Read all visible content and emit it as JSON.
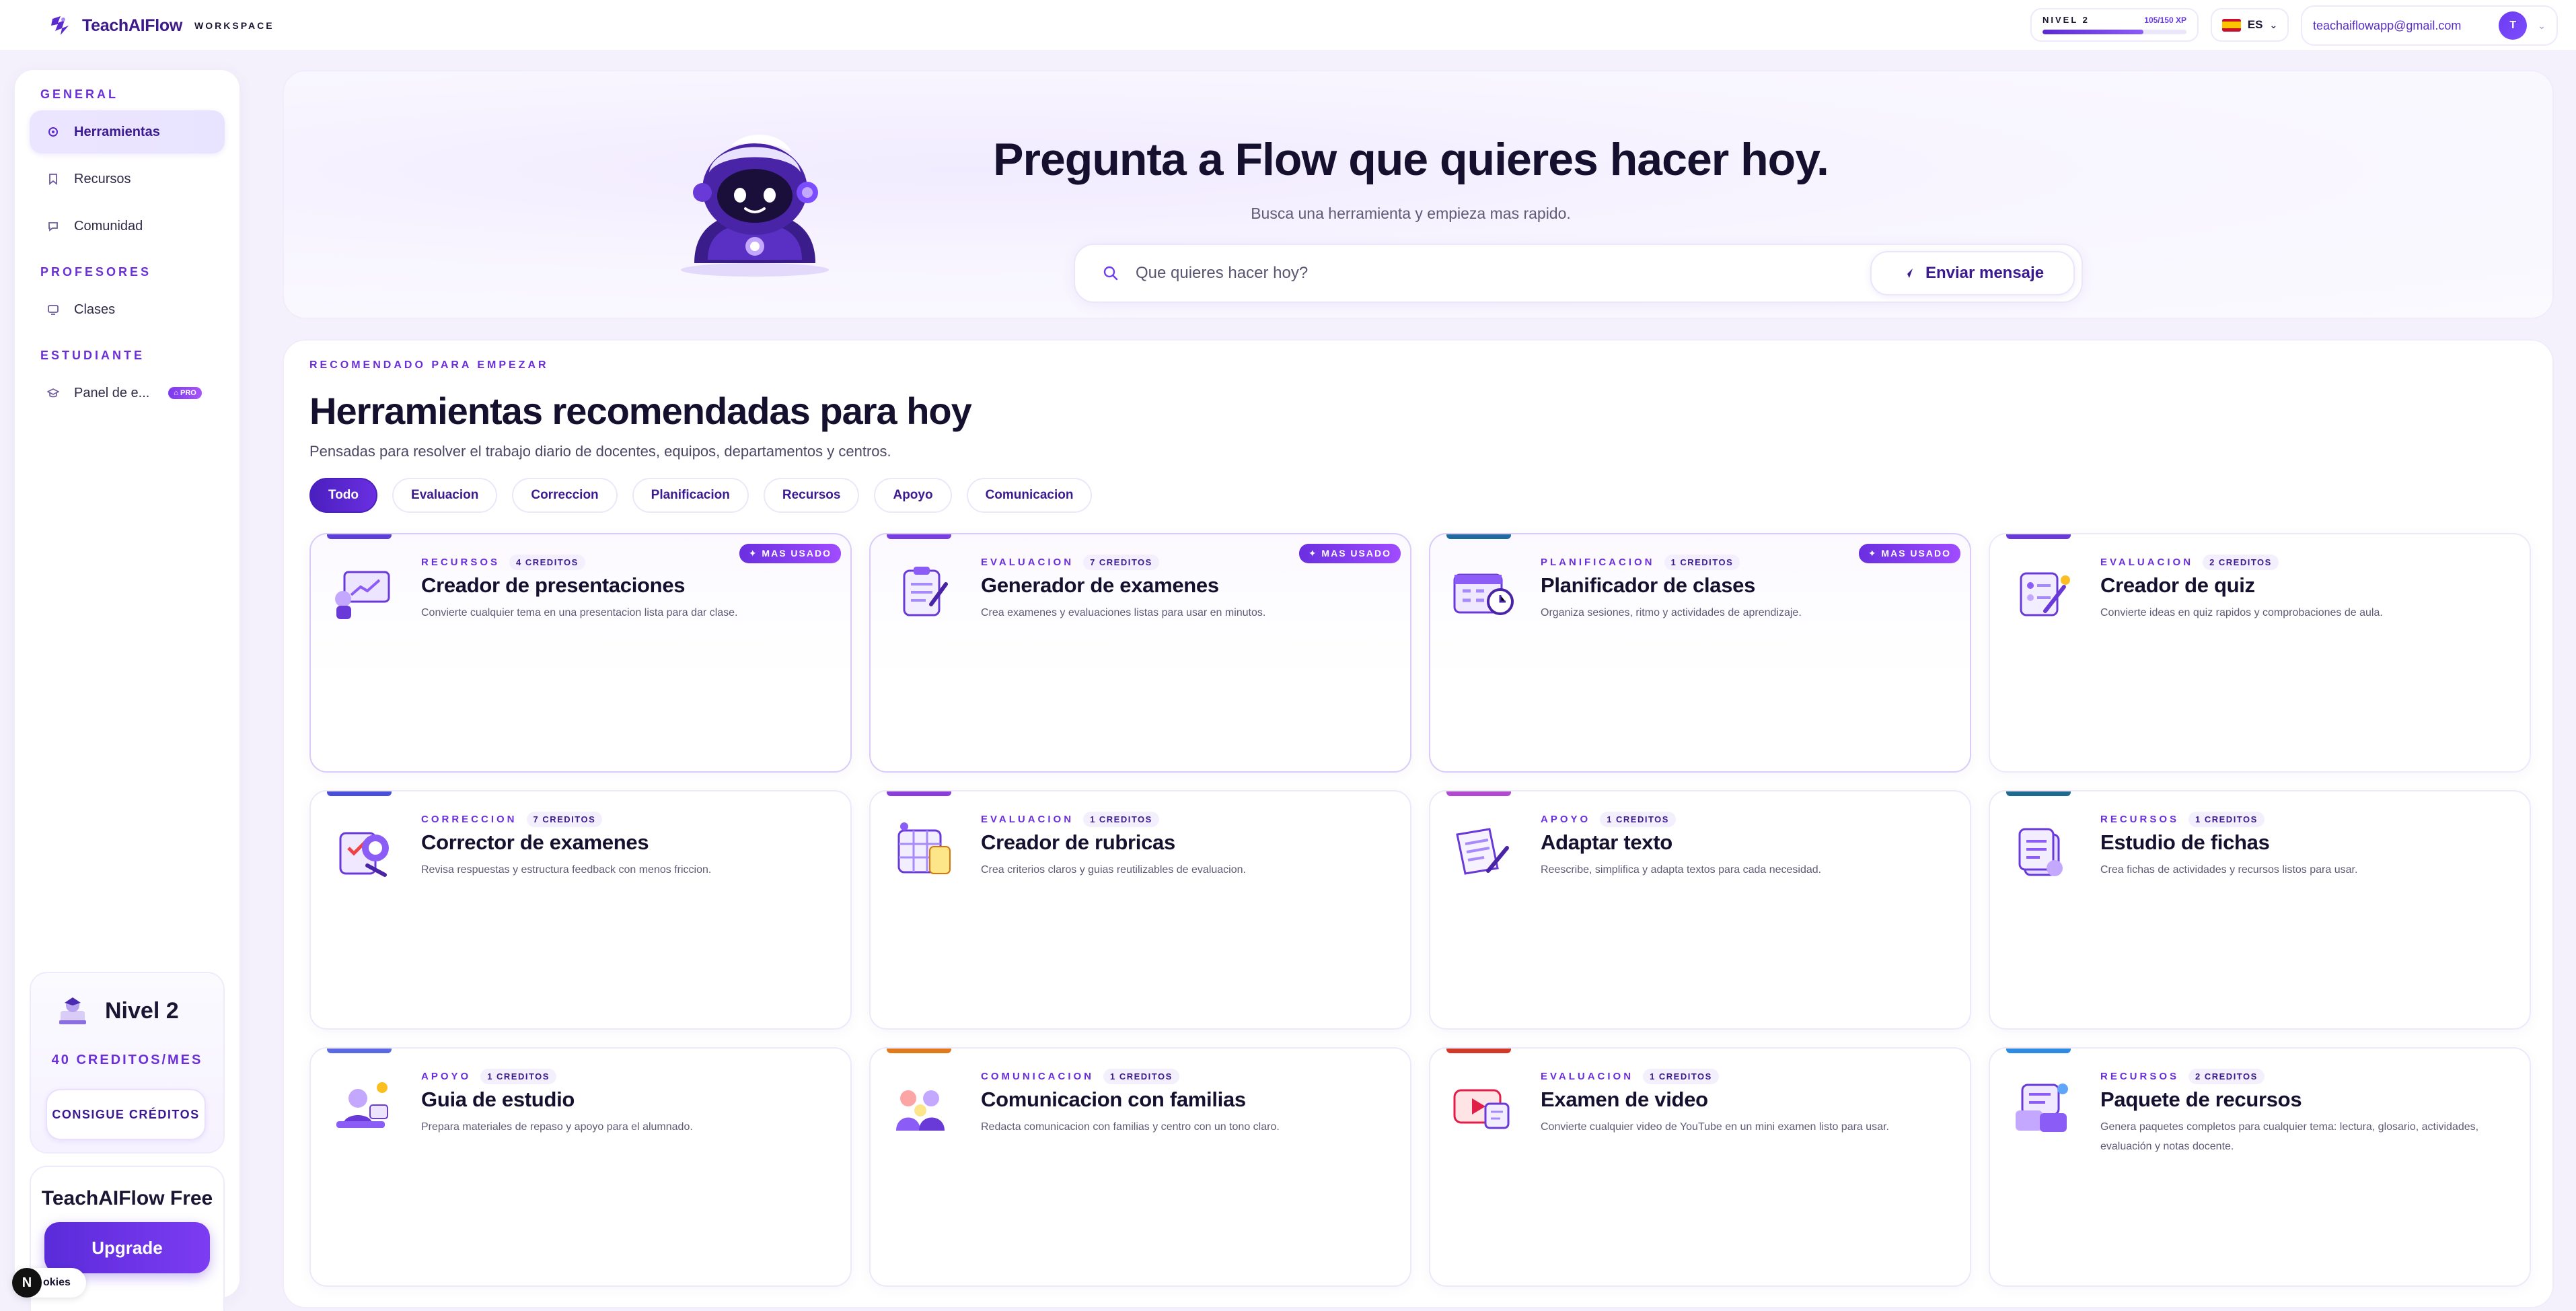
{
  "app": {
    "name": "TeachAIFlow",
    "workspace_label": "WORKSPACE"
  },
  "topbar": {
    "level_label": "NIVEL 2",
    "xp_text": "105/150 XP",
    "xp_progress": 0.7,
    "language": "ES",
    "user_email": "teachaiflowapp@gmail.com",
    "avatar_initial": "T"
  },
  "sidebar": {
    "sections": {
      "general": "GENERAL",
      "profesores": "PROFESORES",
      "estudiante": "ESTUDIANTE"
    },
    "items": [
      {
        "label": "Herramientas",
        "icon": "sparkle-gear-icon"
      },
      {
        "label": "Recursos",
        "icon": "bookmark-icon"
      },
      {
        "label": "Comunidad",
        "icon": "chat-bubble-icon"
      },
      {
        "label": "Clases",
        "icon": "monitor-icon"
      },
      {
        "label": "Panel de e...",
        "icon": "graduation-cap-icon",
        "badge": "PRO"
      }
    ],
    "level_card": {
      "title": "Nivel 2",
      "credits": "40 CREDITOS/MES",
      "button": "CONSIGUE CRÉDITOS"
    },
    "free_card": {
      "title": "TeachAIFlow Free",
      "button": "Upgrade"
    },
    "cookie_label": "okies",
    "cookie_badge": "N"
  },
  "hero": {
    "title": "Pregunta a Flow que quieres hacer hoy.",
    "subtitle": "Busca una herramienta y empieza mas rapido.",
    "search_placeholder": "Que quieres hacer hoy?",
    "send_label": "Enviar mensaje"
  },
  "tools": {
    "eyebrow": "RECOMENDADO PARA EMPEZAR",
    "title": "Herramientas recomendadas para hoy",
    "subtitle": "Pensadas para resolver el trabajo diario de docentes, equipos, departamentos y centros.",
    "filters": [
      "Todo",
      "Evaluacion",
      "Correccion",
      "Planificacion",
      "Recursos",
      "Apoyo",
      "Comunicacion"
    ],
    "active_filter": "Todo",
    "top_badge": "✦ MAS USADO",
    "cards": [
      {
        "category": "RECURSOS",
        "credits": "4 CREDITOS",
        "title": "Creador de presentaciones",
        "desc": "Convierte cualquier tema en una presentacion lista para dar clase.",
        "top": true,
        "accent": "#5b3fd6",
        "icon": "presentation-icon"
      },
      {
        "category": "EVALUACION",
        "credits": "7 CREDITOS",
        "title": "Generador de examenes",
        "desc": "Crea examenes y evaluaciones listas para usar en minutos.",
        "top": true,
        "accent": "#7a3fe0",
        "icon": "exam-clipboard-icon"
      },
      {
        "category": "PLANIFICACION",
        "credits": "1 CREDITOS",
        "title": "Planificador de clases",
        "desc": "Organiza sesiones, ritmo y actividades de aprendizaje.",
        "top": true,
        "accent": "#1f6a9e",
        "icon": "calendar-clock-icon"
      },
      {
        "category": "EVALUACION",
        "credits": "2 CREDITOS",
        "title": "Creador de quiz",
        "desc": "Convierte ideas en quiz rapidos y comprobaciones de aula.",
        "top": false,
        "accent": "#6a3ad8",
        "icon": "quiz-pencil-icon"
      },
      {
        "category": "CORRECCION",
        "credits": "7 CREDITOS",
        "title": "Corrector de examenes",
        "desc": "Revisa respuestas y estructura feedback con menos friccion.",
        "top": false,
        "accent": "#4a4fd8",
        "icon": "grading-icon"
      },
      {
        "category": "EVALUACION",
        "credits": "1 CREDITOS",
        "title": "Creador de rubricas",
        "desc": "Crea criterios claros y guias reutilizables de evaluacion.",
        "top": false,
        "accent": "#8a3fd8",
        "icon": "rubric-grid-icon"
      },
      {
        "category": "APOYO",
        "credits": "1 CREDITOS",
        "title": "Adaptar texto",
        "desc": "Reescribe, simplifica y adapta textos para cada necesidad.",
        "top": false,
        "accent": "#b04bd0",
        "icon": "text-pencil-icon"
      },
      {
        "category": "RECURSOS",
        "credits": "1 CREDITOS",
        "title": "Estudio de fichas",
        "desc": "Crea fichas de actividades y recursos listos para usar.",
        "top": false,
        "accent": "#1f6a8e",
        "icon": "worksheet-stack-icon"
      },
      {
        "category": "APOYO",
        "credits": "1 CREDITOS",
        "title": "Guia de estudio",
        "desc": "Prepara materiales de repaso y apoyo para el alumnado.",
        "top": false,
        "accent": "#5b6ae0",
        "icon": "student-desk-icon"
      },
      {
        "category": "COMUNICACION",
        "credits": "1 CREDITOS",
        "title": "Comunicacion con familias",
        "desc": "Redacta comunicacion con familias y centro con un tono claro.",
        "top": false,
        "accent": "#e07a1f",
        "icon": "family-group-icon"
      },
      {
        "category": "EVALUACION",
        "credits": "1 CREDITOS",
        "title": "Examen de video",
        "desc": "Convierte cualquier video de YouTube en un mini examen listo para usar.",
        "top": false,
        "accent": "#d03a2a",
        "icon": "video-play-icon"
      },
      {
        "category": "RECURSOS",
        "credits": "2 CREDITOS",
        "title": "Paquete de recursos",
        "desc": "Genera paquetes completos para cualquier tema: lectura, glosario, actividades, evaluación y notas docente.",
        "top": false,
        "accent": "#2f8ae0",
        "icon": "resource-bundle-icon"
      }
    ]
  },
  "colors": {
    "accent": "#6a2fd8",
    "deep": "#3b1a91",
    "background": "#f4f1fc"
  }
}
